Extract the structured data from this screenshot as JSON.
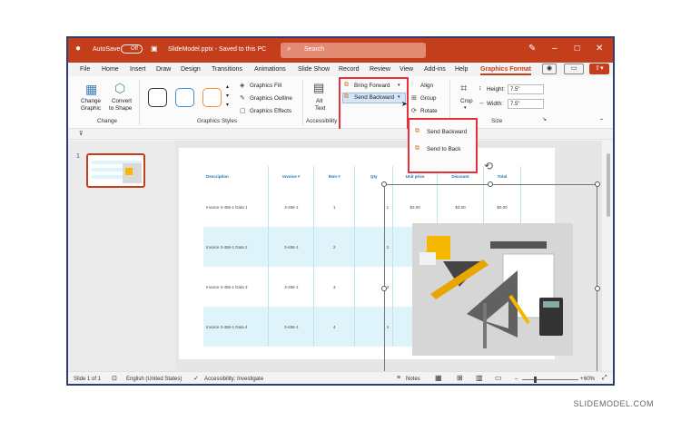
{
  "titlebar": {
    "autosave_label": "AutoSave",
    "autosave_state": "Off",
    "filename": "SlideModel.pptx - Saved to this PC",
    "search_placeholder": "Search"
  },
  "menu": [
    "File",
    "Home",
    "Insert",
    "Draw",
    "Design",
    "Transitions",
    "Animations",
    "Slide Show",
    "Record",
    "Review",
    "View",
    "Add-ins",
    "Help",
    "Graphics Format"
  ],
  "ribbon": {
    "change": {
      "change_graphic_1": "Change",
      "change_graphic_2": "Graphic",
      "convert_1": "Convert",
      "convert_2": "to Shape",
      "group": "Change"
    },
    "styles": {
      "fill": "Graphics Fill",
      "outline": "Graphics Outline",
      "effects": "Graphics Effects",
      "group": "Graphics Styles"
    },
    "accessibility": {
      "alt_1": "Alt",
      "alt_2": "Text",
      "group": "Accessibility"
    },
    "arrange": {
      "bring_forward": "Bring Forward",
      "send_backward": "Send Backward",
      "align": "Align",
      "group_label": "Group",
      "rotate": "Rotate"
    },
    "crop": {
      "label": "Crop"
    },
    "size": {
      "height_label": "Height:",
      "height_value": "7.5\"",
      "width_label": "Width:",
      "width_value": "7.5\"",
      "group": "Size"
    }
  },
  "dropdown": {
    "items": [
      "Send Backward",
      "Send to Back"
    ]
  },
  "thumbnail": {
    "number": "1"
  },
  "table": {
    "headers": [
      "Description",
      "Invoice #",
      "Item #",
      "Qty",
      "Unit price",
      "Discount",
      "Total"
    ],
    "rows": [
      [
        "Invoice 3-456-1 Data 1",
        "3-456-1",
        "1",
        "1",
        "$3.00",
        "$3.00",
        "$0.00"
      ],
      [
        "Invoice 3-456-1 Data 2",
        "3-456-1",
        "2",
        "2",
        "",
        "",
        ""
      ],
      [
        "Invoice 3-456-1 Data 3",
        "3-456-1",
        "3",
        "3",
        "",
        "",
        ""
      ],
      [
        "Invoice 3-456-1 Data 4",
        "3-456-1",
        "4",
        "4",
        "",
        "",
        ""
      ]
    ]
  },
  "status": {
    "slide": "Slide 1 of 1",
    "language": "English (United States)",
    "accessibility": "Accessibility: Investigate",
    "notes": "Notes",
    "zoom": "60%"
  },
  "colors": {
    "accent": "#c43e1c",
    "popup_border": "#e8303a",
    "table_header": "#1e72a8",
    "table_alt": "#def4fa"
  },
  "watermark": "SLIDEMODEL.COM"
}
